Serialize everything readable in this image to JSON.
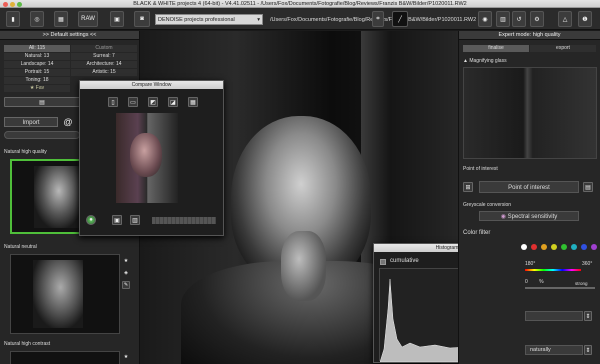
{
  "window": {
    "title": "BLACK & WHITE projects 4 (64-bit) - V4.41.02511 - /Users/Fox/Documents/Fotografie/Blog/Reviews/Franzis B&W/Bilder/P1020011.RW2"
  },
  "toolbar": {
    "raw_label": "RAW",
    "denoise_select": "DENOISE projects professional"
  },
  "left_panel": {
    "preset_header": ">> Default settings <<",
    "categories": [
      {
        "label": "All: 115",
        "active": true
      },
      {
        "label": "Custom",
        "active": false
      },
      {
        "label": "Natural: 13"
      },
      {
        "label": "Surreal: 7"
      },
      {
        "label": "Landscape: 14"
      },
      {
        "label": "Architecture: 14"
      },
      {
        "label": "Portrait: 15"
      },
      {
        "label": "Artistic: 15"
      },
      {
        "label": "Toning: 18"
      },
      {
        "label": "Fav"
      }
    ],
    "import_label": "Import",
    "presets": [
      {
        "label": "Natural high quality"
      },
      {
        "label": "Natural neutral"
      },
      {
        "label": "Natural high contrast"
      }
    ]
  },
  "compare_window": {
    "title": "Compare Window"
  },
  "histogram": {
    "title": "Histogram",
    "channel_label": "cumulative"
  },
  "right_panel": {
    "mode_header": "Expert mode: high quality",
    "tabs": [
      "finalise",
      "export"
    ],
    "magnifier_label": "Magnifying glass",
    "point_of_interest_header": "Point of interest",
    "point_of_interest_button": "Point of interest",
    "greyscale_header": "Greyscale conversion",
    "spectral_button": "Spectral sensitivity",
    "color_filter_label": "Color filter",
    "slider_value_1": "180",
    "slider_unit_1": "°",
    "slider_max_1": "360°",
    "slider_value_2": "0",
    "slider_unit_2": "%",
    "slider_label_2": "strong",
    "bottom_select": "naturally",
    "swatch_colors": [
      "#ffffff",
      "#e03030",
      "#e0a020",
      "#d0d020",
      "#30c030",
      "#20b0c0",
      "#3050e0",
      "#a040d0"
    ]
  }
}
